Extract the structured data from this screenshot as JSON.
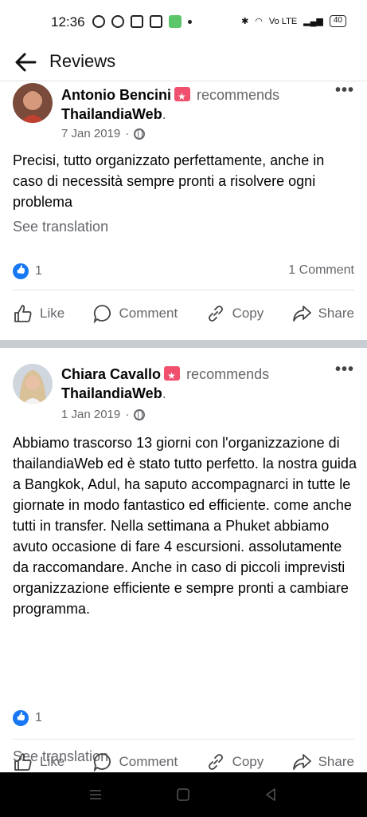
{
  "status": {
    "time": "12:36",
    "battery": "40",
    "network": "Vo LTE"
  },
  "header": {
    "title": "Reviews"
  },
  "posts": [
    {
      "author": "Antonio Bencini",
      "recommends_label": "recommends",
      "page": "ThailandiaWeb",
      "date": "7 Jan 2019",
      "meta_sep": "·",
      "text": "Precisi, tutto organizzato perfettamente, anche in caso di necessità sempre pronti a risolvere ogni problema",
      "see_translation": "See translation",
      "likes": "1",
      "comments": "1 Comment"
    },
    {
      "author": "Chiara Cavallo",
      "recommends_label": "recommends",
      "page": "ThailandiaWeb",
      "date": "1 Jan 2019",
      "meta_sep": "·",
      "text": "Abbiamo trascorso 13 giorni con l'organizzazione di thailandiaWeb ed è stato tutto perfetto. la nostra guida a Bangkok, Adul, ha saputo accompagnarci in tutte le giornate in modo fantastico ed efficiente. come anche tutti in transfer. Nella settimana a Phuket abbiamo avuto occasione di fare 4 escursioni. assolutamente da raccomandare. Anche in caso di piccoli imprevisti organizzazione efficiente e sempre pronti a cambiare programma.",
      "see_translation": "See translation",
      "likes": "1"
    }
  ],
  "actions": {
    "like": "Like",
    "comment": "Comment",
    "copy": "Copy",
    "share": "Share"
  },
  "colors": {
    "accent": "#1877f2",
    "muted": "#65676b",
    "badge": "#f0506e"
  }
}
